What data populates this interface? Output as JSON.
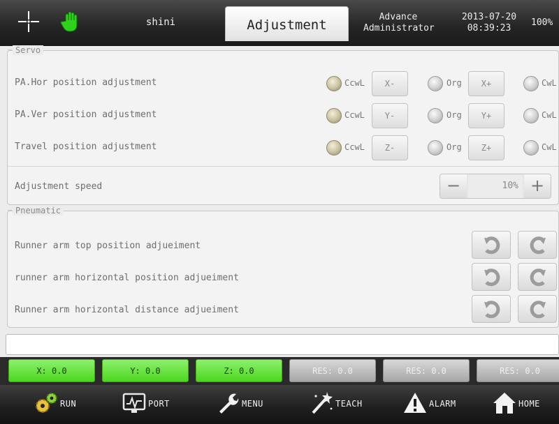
{
  "header": {
    "user": "shini",
    "page_title": "Adjustment",
    "mode_line1": "Advance",
    "mode_line2": "Administrator",
    "date": "2013-07-20",
    "time": "08:39:23",
    "percent": "100%",
    "icons": [
      "crosshair-icon",
      "hand-icon"
    ]
  },
  "servo": {
    "legend": "Servo",
    "rows": [
      {
        "label": "PA.Hor position adjustment",
        "ccw": "CcwL",
        "minus": "X-",
        "org": "Org",
        "plus": "X+",
        "cw": "CwL",
        "ccw_active": true
      },
      {
        "label": "PA.Ver position adjustment",
        "ccw": "CcwL",
        "minus": "Y-",
        "org": "Org",
        "plus": "Y+",
        "cw": "CwL",
        "ccw_active": true
      },
      {
        "label": "Travel position adjustment",
        "ccw": "CcwL",
        "minus": "Z-",
        "org": "Org",
        "plus": "Z+",
        "cw": "CwL",
        "ccw_active": true
      }
    ],
    "speed_label": "Adjustment speed",
    "speed_value": "10%",
    "speed_minus": "−",
    "speed_plus": "+"
  },
  "pneumatic": {
    "legend": "Pneumatic",
    "rows": [
      {
        "label": "Runner arm top position adjueiment"
      },
      {
        "label": "runner arm horizontal position adjueiment"
      },
      {
        "label": "Runner arm horizontal distance adjueiment"
      }
    ],
    "icons": [
      "rotate-left-icon",
      "rotate-right-icon"
    ]
  },
  "message": "",
  "coords": [
    {
      "label": "X: 0.0",
      "active": true
    },
    {
      "label": "Y: 0.0",
      "active": true
    },
    {
      "label": "Z: 0.0",
      "active": true
    },
    {
      "label": "RES: 0.0",
      "active": false
    },
    {
      "label": "RES: 0.0",
      "active": false
    },
    {
      "label": "RES: 0.0",
      "active": false
    }
  ],
  "nav": [
    {
      "label": "RUN",
      "icon": "gears-icon"
    },
    {
      "label": "PORT",
      "icon": "monitor-icon"
    },
    {
      "label": "MENU",
      "icon": "wrench-icon"
    },
    {
      "label": "TEACH",
      "icon": "magic-wand-icon"
    },
    {
      "label": "ALARM",
      "icon": "warning-icon"
    },
    {
      "label": "HOME",
      "icon": "home-icon"
    }
  ],
  "colors": {
    "active_green": "#4cd61e",
    "inactive_grey": "#a6a6a6",
    "header_dark": "#262626"
  }
}
